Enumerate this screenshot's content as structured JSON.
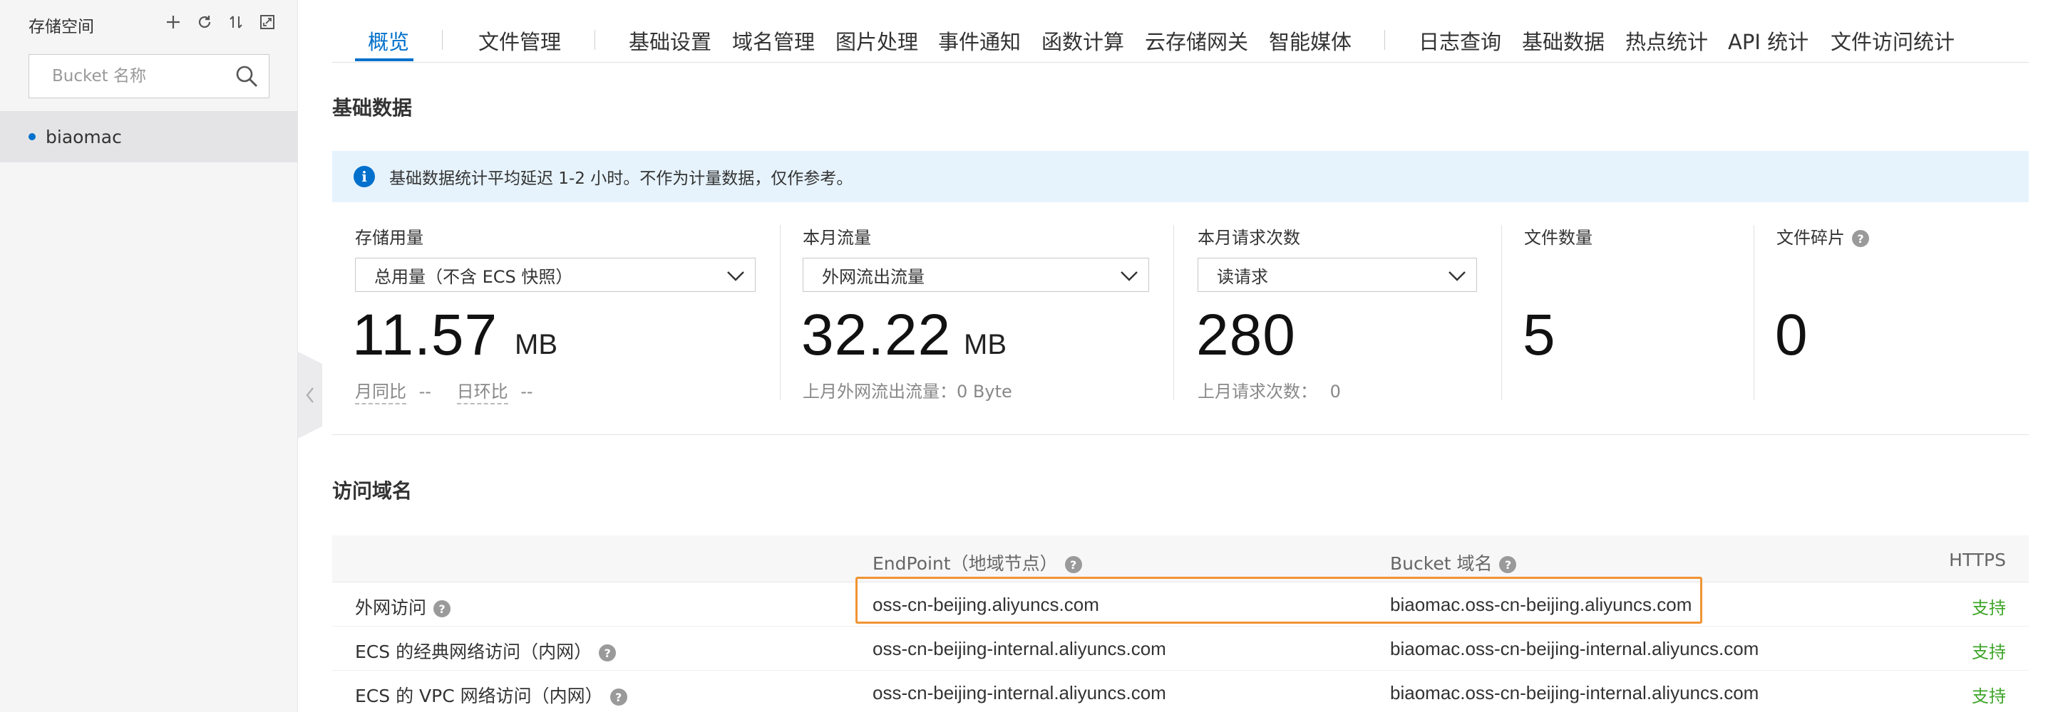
{
  "sidebar": {
    "title": "存储空间",
    "search_placeholder": "Bucket 名称",
    "buckets": [
      {
        "name": "biaomac",
        "selected": true
      }
    ]
  },
  "tabs": {
    "items": [
      "概览",
      "文件管理",
      "基础设置",
      "域名管理",
      "图片处理",
      "事件通知",
      "函数计算",
      "云存储网关",
      "智能媒体",
      "日志查询",
      "基础数据",
      "热点统计",
      "API 统计",
      "文件访问统计"
    ],
    "active": "概览"
  },
  "basic_data": {
    "title": "基础数据",
    "notice": "基础数据统计平均延迟 1-2 小时。不作为计量数据，仅作参考。",
    "storage": {
      "label": "存储用量",
      "select": "总用量（不含 ECS 快照）",
      "value": "11.57",
      "unit": "MB",
      "mom_label": "月同比",
      "mom_value": "--",
      "dod_label": "日环比",
      "dod_value": "--"
    },
    "traffic": {
      "label": "本月流量",
      "select": "外网流出流量",
      "value": "32.22",
      "unit": "MB",
      "last_month": "上月外网流出流量：0 Byte"
    },
    "requests": {
      "label": "本月请求次数",
      "select": "读请求",
      "value": "280",
      "last_month_label": "上月请求次数：",
      "last_month_value": "0"
    },
    "files": {
      "label": "文件数量",
      "value": "5"
    },
    "fragments": {
      "label": "文件碎片",
      "value": "0"
    }
  },
  "access_domain": {
    "title": "访问域名",
    "columns": {
      "endpoint": "EndPoint（地域节点）",
      "bucket_domain": "Bucket 域名",
      "https": "HTTPS"
    },
    "rows": [
      {
        "label": "外网访问",
        "endpoint": "oss-cn-beijing.aliyuncs.com",
        "bucket_domain": "biaomac.oss-cn-beijing.aliyuncs.com",
        "https": "支持"
      },
      {
        "label": "ECS 的经典网络访问（内网）",
        "endpoint": "oss-cn-beijing-internal.aliyuncs.com",
        "bucket_domain": "biaomac.oss-cn-beijing-internal.aliyuncs.com",
        "https": "支持"
      },
      {
        "label": "ECS 的 VPC 网络访问（内网）",
        "endpoint": "oss-cn-beijing-internal.aliyuncs.com",
        "bucket_domain": "biaomac.oss-cn-beijing-internal.aliyuncs.com",
        "https": "支持"
      }
    ]
  },
  "colors": {
    "primary": "#0070cc",
    "notice_bg": "#e6f3fc",
    "support_green": "#3fa52a",
    "highlight": "#f09433"
  }
}
